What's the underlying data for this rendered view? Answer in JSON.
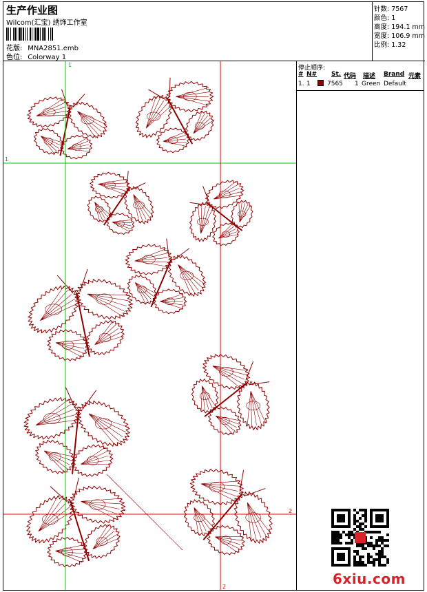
{
  "header": {
    "title": "生产作业图",
    "company": "Wilcom(汇宝) 绣饰工作室",
    "design_label": "花版:",
    "design_value": "MNA2851.emb",
    "colorway_label": "色位:",
    "colorway_value": "Colorway 1"
  },
  "stats": {
    "stitches": "针数: 7567",
    "colors": "颜色: 1",
    "height": "高度: 194.1 mm",
    "width": "宽度: 106.9 mm",
    "scale": "比例: 1.32"
  },
  "stop_sequence": {
    "title": "停止顺序:",
    "columns": [
      "#",
      "N#",
      "St.",
      "代码",
      "描述",
      "Brand",
      "元素"
    ],
    "rows": [
      {
        "index": "1.",
        "needle": "1",
        "code": "7565",
        "stops": "1",
        "description": "Green",
        "brand": "Default",
        "color": "#8b0000"
      }
    ]
  },
  "guides": {
    "v1_label": "1",
    "h1_label": "1",
    "v2_label": "2",
    "h2_label": "2"
  },
  "watermark": {
    "qr_icon": "qr-code-icon",
    "site": "6xiu.com"
  },
  "colors": {
    "thread": "#8b0000",
    "guide_green": "#00cc00",
    "guide_red": "#dd0000"
  }
}
